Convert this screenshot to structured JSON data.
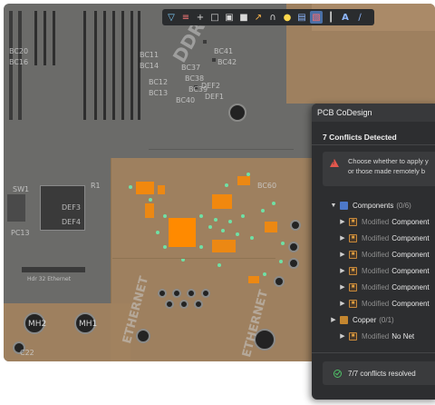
{
  "toolbar": {
    "icons": [
      "filter-icon",
      "route-icon",
      "place-icon",
      "select-rect-icon",
      "component-icon",
      "fill-icon",
      "probe-icon",
      "arc-icon",
      "bulb-icon",
      "layer-icon",
      "highlight-icon",
      "chart-icon",
      "text-icon",
      "pen-icon"
    ]
  },
  "board": {
    "silk": {
      "ddr": "DDR",
      "ethernet1": "ETHERNET",
      "ethernet2": "ETHERNET",
      "mh2": "MH2",
      "mh1": "MH1",
      "bc11": "BC11",
      "bc14": "BC14",
      "bc12": "BC12",
      "bc13": "BC13",
      "bc37": "BC37",
      "bc38": "BC38",
      "bc39": "BC39",
      "bc40": "BC40",
      "bc41": "BC41",
      "bc42": "BC42",
      "bc20": "BC20",
      "bc16": "BC16",
      "def2": "DEF2",
      "def1": "DEF1",
      "def3": "DEF3",
      "def4": "DEF4",
      "pc13": "PC13",
      "hdr": "Hdr 32 Ethernet",
      "bc60": "BC60",
      "sw1": "SW1",
      "r1": "R1",
      "c22": "C22"
    }
  },
  "panel": {
    "title": "PCB CoDesign",
    "subtitle": "7 Conflicts Detected",
    "warning_line1": "Choose whether to apply y",
    "warning_line2": "or those made remotely b",
    "groups": [
      {
        "label": "Components",
        "count": "(0/6)",
        "expanded": true
      },
      {
        "label": "Copper",
        "count": "(0/1)",
        "expanded": true
      }
    ],
    "component_items": [
      {
        "status": "Modified",
        "name": "Component"
      },
      {
        "status": "Modified",
        "name": "Component"
      },
      {
        "status": "Modified",
        "name": "Component"
      },
      {
        "status": "Modified",
        "name": "Component"
      },
      {
        "status": "Modified",
        "name": "Component"
      },
      {
        "status": "Modified",
        "name": "Component"
      }
    ],
    "copper_items": [
      {
        "status": "Modified",
        "name": "No Net"
      }
    ],
    "resolved_text": "7/7 conflicts resolved"
  },
  "colors": {
    "board_grey": "#6b6b69",
    "board_tan": "#a1825f",
    "highlight_orange": "#ff8a00",
    "panel_bg": "#2d2e30",
    "warning_red": "#e3574d",
    "success_green": "#4fc167",
    "component_blue": "#4d78c9"
  }
}
